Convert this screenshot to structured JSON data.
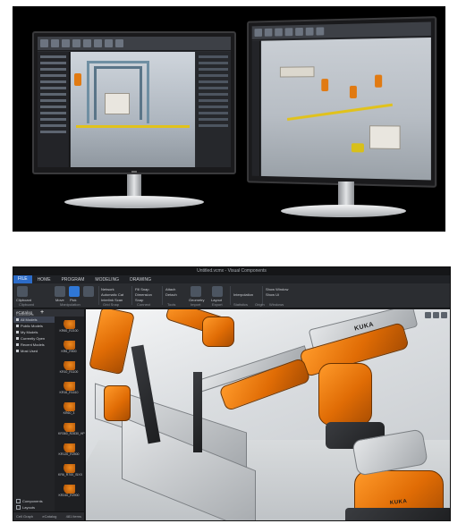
{
  "app": {
    "title": "Untitled.vcmx - Visual Components",
    "menu": {
      "file": "FILE",
      "tabs": [
        "HOME",
        "PROGRAM",
        "MODELING",
        "DRAWING"
      ]
    },
    "ribbon": {
      "buttons": [
        "Clipboard",
        "Move",
        "Pick"
      ],
      "controls": [
        "Network",
        "Automatic Cat",
        "Interlink Scan",
        "Fill Snap",
        "Dimension",
        "Snap",
        "Attach",
        "Detach",
        "Geometry",
        "Layout",
        "Interpolation",
        "Show Window",
        "Show Ui"
      ],
      "groups": [
        "Clipboard",
        "Manipulation",
        "Grid Snap",
        "Connect",
        "Tools",
        "Import",
        "Export",
        "Statistics",
        "Origin",
        "Windows"
      ]
    },
    "catalog": {
      "title": "eCatalog",
      "collections_label": "Collections",
      "collections": [
        "All Models",
        "Public Models",
        "My Models",
        "Currently Open",
        "Recent Models",
        "Most Used"
      ],
      "checks": [
        "Components",
        "Layouts",
        "Files"
      ],
      "items": [
        "KR60_R2100",
        "KR6_R900",
        "KR10_R1100",
        "KR16_R1610",
        "KR60_3",
        "KR360_R2830_HP",
        "KR120_R2500",
        "KR6_R700_SIXX",
        "KR240_R2900"
      ],
      "footer_left": "Cell Graph",
      "footer_tab": "eCatalog",
      "footer_count": "481 items"
    },
    "viewport": {
      "brand_labels": [
        "KUKA",
        "KUKA"
      ]
    }
  },
  "icons": [
    "add-icon",
    "viewport-toolbar-icon"
  ]
}
